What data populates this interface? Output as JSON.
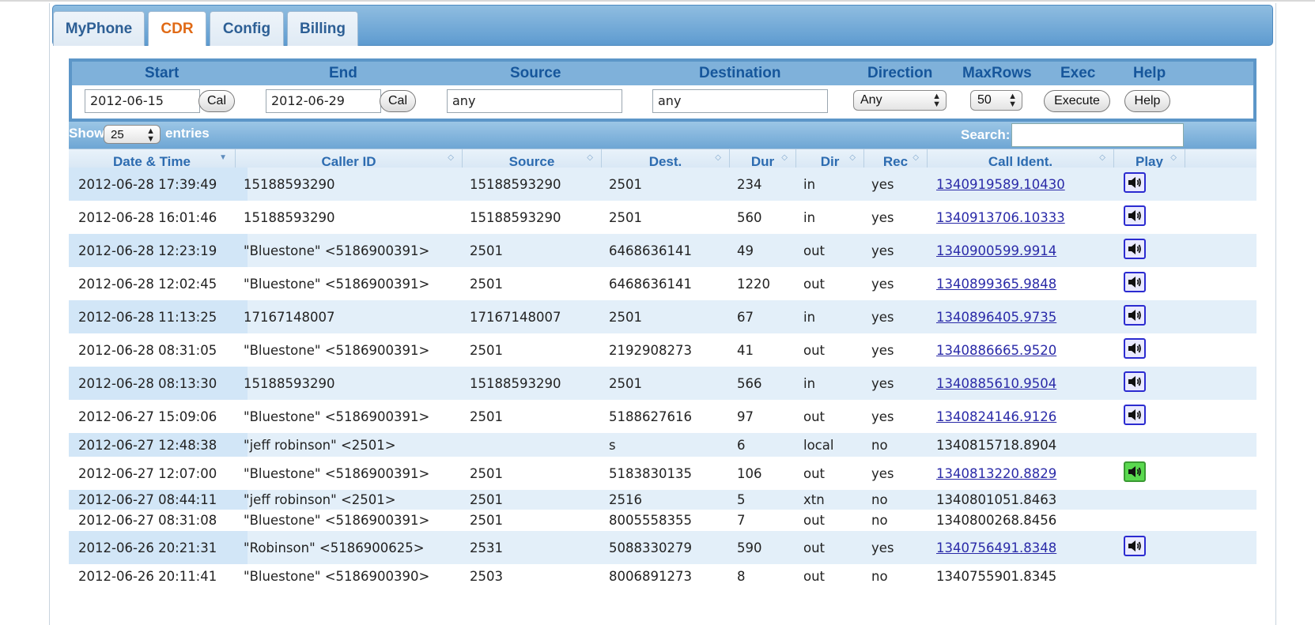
{
  "tabs": [
    {
      "label": "MyPhone",
      "active": false
    },
    {
      "label": "CDR",
      "active": true
    },
    {
      "label": "Config",
      "active": false
    },
    {
      "label": "Billing",
      "active": false
    }
  ],
  "filter": {
    "labels": {
      "start": "Start",
      "end": "End",
      "source": "Source",
      "destination": "Destination",
      "direction": "Direction",
      "maxrows": "MaxRows",
      "exec": "Exec",
      "help": "Help"
    },
    "start_value": "2012-06-15",
    "end_value": "2012-06-29",
    "source_value": "any",
    "destination_value": "any",
    "direction_value": "Any",
    "maxrows_value": "50",
    "cal_label": "Cal",
    "execute_label": "Execute",
    "help_button_label": "Help"
  },
  "showbar": {
    "show_label": "Show",
    "entries_value": "25",
    "entries_label": "entries",
    "search_label": "Search:"
  },
  "columns": [
    "Date & Time",
    "Caller ID",
    "Source",
    "Dest.",
    "Dur",
    "Dir",
    "Rec",
    "Call Ident.",
    "Play"
  ],
  "rows": [
    {
      "datetime": "2012-06-28 17:39:49",
      "callerid": "15188593290",
      "source": "15188593290",
      "dest": "2501",
      "dur": "234",
      "dir": "in",
      "rec": "yes",
      "ident": "1340919589.10430",
      "linked": true,
      "play": "blue"
    },
    {
      "datetime": "2012-06-28 16:01:46",
      "callerid": "15188593290",
      "source": "15188593290",
      "dest": "2501",
      "dur": "560",
      "dir": "in",
      "rec": "yes",
      "ident": "1340913706.10333",
      "linked": true,
      "play": "blue"
    },
    {
      "datetime": "2012-06-28 12:23:19",
      "callerid": "\"Bluestone\" <5186900391>",
      "source": "2501",
      "dest": "6468636141",
      "dur": "49",
      "dir": "out",
      "rec": "yes",
      "ident": "1340900599.9914",
      "linked": true,
      "play": "blue"
    },
    {
      "datetime": "2012-06-28 12:02:45",
      "callerid": "\"Bluestone\" <5186900391>",
      "source": "2501",
      "dest": "6468636141",
      "dur": "1220",
      "dir": "out",
      "rec": "yes",
      "ident": "1340899365.9848",
      "linked": true,
      "play": "blue"
    },
    {
      "datetime": "2012-06-28 11:13:25",
      "callerid": "17167148007",
      "source": "17167148007",
      "dest": "2501",
      "dur": "67",
      "dir": "in",
      "rec": "yes",
      "ident": "1340896405.9735",
      "linked": true,
      "play": "blue"
    },
    {
      "datetime": "2012-06-28 08:31:05",
      "callerid": "\"Bluestone\" <5186900391>",
      "source": "2501",
      "dest": "2192908273",
      "dur": "41",
      "dir": "out",
      "rec": "yes",
      "ident": "1340886665.9520",
      "linked": true,
      "play": "blue"
    },
    {
      "datetime": "2012-06-28 08:13:30",
      "callerid": "15188593290",
      "source": "15188593290",
      "dest": "2501",
      "dur": "566",
      "dir": "in",
      "rec": "yes",
      "ident": "1340885610.9504",
      "linked": true,
      "play": "blue"
    },
    {
      "datetime": "2012-06-27 15:09:06",
      "callerid": "\"Bluestone\" <5186900391>",
      "source": "2501",
      "dest": "5188627616",
      "dur": "97",
      "dir": "out",
      "rec": "yes",
      "ident": "1340824146.9126",
      "linked": true,
      "play": "blue"
    },
    {
      "datetime": "2012-06-27 12:48:38",
      "callerid": "\"jeff robinson\" <2501>",
      "source": "",
      "dest": "s",
      "dur": "6",
      "dir": "local",
      "rec": "no",
      "ident": "1340815718.8904",
      "linked": false,
      "play": "none"
    },
    {
      "datetime": "2012-06-27 12:07:00",
      "callerid": "\"Bluestone\" <5186900391>",
      "source": "2501",
      "dest": "5183830135",
      "dur": "106",
      "dir": "out",
      "rec": "yes",
      "ident": "1340813220.8829",
      "linked": true,
      "play": "green"
    },
    {
      "datetime": "2012-06-27 08:44:11",
      "callerid": "\"jeff robinson\" <2501>",
      "source": "2501",
      "dest": "2516",
      "dur": "5",
      "dir": "xtn",
      "rec": "no",
      "ident": "1340801051.8463",
      "linked": false,
      "play": "none"
    },
    {
      "datetime": "2012-06-27 08:31:08",
      "callerid": "\"Bluestone\" <5186900391>",
      "source": "2501",
      "dest": "8005558355",
      "dur": "7",
      "dir": "out",
      "rec": "no",
      "ident": "1340800268.8456",
      "linked": false,
      "play": "none"
    },
    {
      "datetime": "2012-06-26 20:21:31",
      "callerid": "\"Robinson\" <5186900625>",
      "source": "2531",
      "dest": "5088330279",
      "dur": "590",
      "dir": "out",
      "rec": "yes",
      "ident": "1340756491.8348",
      "linked": true,
      "play": "blue"
    },
    {
      "datetime": "2012-06-26 20:11:41",
      "callerid": "\"Bluestone\" <5186900390>",
      "source": "2503",
      "dest": "8006891273",
      "dur": "8",
      "dir": "out",
      "rec": "no",
      "ident": "1340755901.8345",
      "linked": false,
      "play": "none"
    }
  ]
}
